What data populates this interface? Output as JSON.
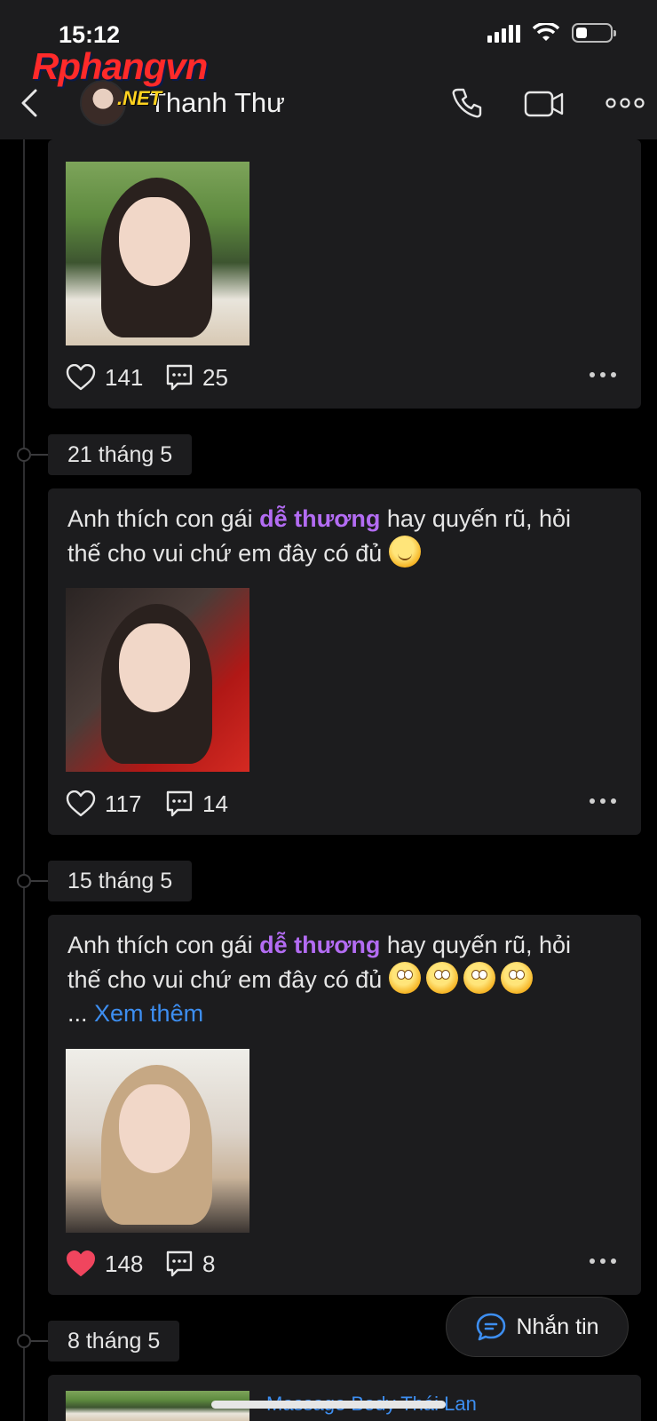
{
  "status_bar": {
    "time": "15:12"
  },
  "watermark": {
    "logo": "Rphangvn",
    "logo_sub": ".NET"
  },
  "header": {
    "contact_name": "Thanh Thư"
  },
  "icons": {
    "back": "chevron-left-icon",
    "call": "phone-icon",
    "video": "video-camera-icon",
    "more": "more-horizontal-icon",
    "like": "heart-icon",
    "comment": "comment-icon",
    "message": "chat-bubble-icon"
  },
  "colors": {
    "background": "#000000",
    "card": "#1c1c1e",
    "highlight": "#b36cf3",
    "link": "#3d8ef0",
    "liked": "#f0455e"
  },
  "posts": [
    {
      "likes": "141",
      "comments": "25",
      "liked": false
    },
    {
      "date": "21 tháng 5",
      "text_before": "Anh thích con gái ",
      "text_highlight": "dễ thương",
      "text_after": " hay quyến rũ, hỏi thế cho vui chứ em đây có đủ",
      "likes": "117",
      "comments": "14",
      "liked": false
    },
    {
      "date": "15 tháng 5",
      "text_before": "Anh thích con gái ",
      "text_highlight": "dễ thương",
      "text_after": " hay quyến rũ, hỏi thế cho vui chứ em đây có đủ",
      "ellipsis": "...",
      "see_more": "Xem thêm",
      "likes": "148",
      "comments": "8",
      "liked": true
    },
    {
      "date": "8 tháng 5",
      "link_preview_title": "Massage Body Thái Lan"
    }
  ],
  "message_button": {
    "label": "Nhắn tin"
  }
}
